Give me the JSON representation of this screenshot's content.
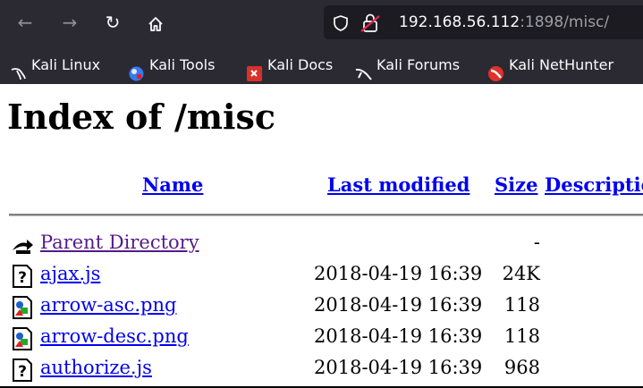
{
  "browser": {
    "nav": {
      "back_icon": "back-arrow-icon",
      "forward_icon": "forward-arrow-icon",
      "reload_icon": "reload-icon",
      "home_icon": "home-icon"
    },
    "url": {
      "host": "192.168.56.112",
      "rest": ":1898/misc/",
      "shield_icon": "shield-icon",
      "insecure_icon": "insecure-lock-icon"
    },
    "bookmarks": [
      {
        "label": "Kali Linux",
        "icon": "kali-dragon-icon"
      },
      {
        "label": "Kali Tools",
        "icon": "kali-tools-icon"
      },
      {
        "label": "Kali Docs",
        "icon": "kali-docs-icon"
      },
      {
        "label": "Kali Forums",
        "icon": "kali-forums-icon"
      },
      {
        "label": "Kali NetHunter",
        "icon": "kali-nethunter-icon"
      }
    ]
  },
  "page": {
    "title": "Index of /misc",
    "columns": {
      "name": "Name",
      "last_modified": "Last modified",
      "size": "Size",
      "description": "Description"
    },
    "rows": [
      {
        "name": "Parent Directory",
        "date": "",
        "size": "-",
        "icon": "back-folder-icon"
      },
      {
        "name": "ajax.js",
        "date": "2018-04-19 16:39",
        "size": "24K",
        "icon": "unknown-file-icon"
      },
      {
        "name": "arrow-asc.png",
        "date": "2018-04-19 16:39",
        "size": "118",
        "icon": "image-file-icon"
      },
      {
        "name": "arrow-desc.png",
        "date": "2018-04-19 16:39",
        "size": "118",
        "icon": "image-file-icon"
      },
      {
        "name": "authorize.js",
        "date": "2018-04-19 16:39",
        "size": "968",
        "icon": "unknown-file-icon"
      }
    ]
  },
  "colors": {
    "chrome_bg": "#2b2a33",
    "urlbar_bg": "#1c1b22",
    "link": "#0000ee",
    "visited_link": "#551a8b"
  }
}
